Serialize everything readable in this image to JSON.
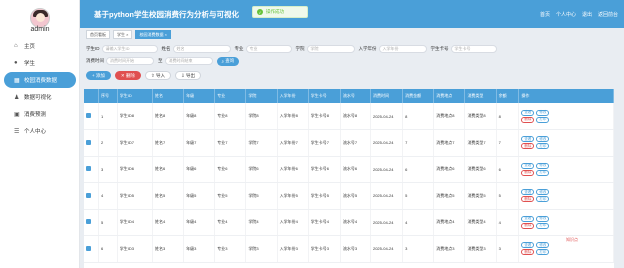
{
  "header": {
    "title": "基于python学生校园消费行为分析与可视化",
    "right_links": [
      "首页",
      "个人中心",
      "退出",
      "返回前台"
    ]
  },
  "toast": {
    "message": "操作成功"
  },
  "sidebar": {
    "username": "admin",
    "items": [
      {
        "label": "主页",
        "icon": "home-icon",
        "active": false
      },
      {
        "label": "学生",
        "icon": "user-icon",
        "active": false
      },
      {
        "label": "校园消费数据",
        "icon": "chart-icon",
        "active": true
      },
      {
        "label": "数据可视化",
        "icon": "person-icon",
        "active": false
      },
      {
        "label": "消费预测",
        "icon": "grid-icon",
        "active": false
      },
      {
        "label": "个人中心",
        "icon": "list-icon",
        "active": false
      }
    ]
  },
  "tabs": [
    {
      "label": "首页看板",
      "active": false
    },
    {
      "label": "学生 ×",
      "active": false
    },
    {
      "label": "校园消费数据 ×",
      "active": true
    }
  ],
  "filters": {
    "row1": [
      {
        "label": "学生ID",
        "placeholder": "请输入学生ID"
      },
      {
        "label": "姓名",
        "placeholder": "姓名"
      },
      {
        "label": "专业",
        "placeholder": "专业"
      },
      {
        "label": "学院",
        "placeholder": "学院"
      },
      {
        "label": "入学年份",
        "placeholder": "入学年份"
      },
      {
        "label": "学生卡号",
        "placeholder": "学生卡号"
      }
    ],
    "row2_label": "消费时间",
    "date_start": "消费时间开始",
    "date_sep": "至",
    "date_end": "消费时间结束",
    "search": "查询"
  },
  "buttons": {
    "add": "添加",
    "delete": "删除",
    "import": "导入",
    "export": "导出"
  },
  "table": {
    "columns": [
      "序号",
      "学生ID",
      "姓名",
      "年级",
      "专业",
      "学院",
      "入学年份",
      "学生卡号",
      "流水号",
      "消费时间",
      "消费金额",
      "消费地点",
      "消费类型",
      "余额",
      "操作"
    ],
    "rows": [
      [
        "1",
        "学生ID8",
        "姓名8",
        "年级8",
        "专业8",
        "学院8",
        "入学年份8",
        "学生卡号8",
        "流水号8",
        "2025-04-24",
        "8",
        "消费地点8",
        "消费类型8",
        "8"
      ],
      [
        "2",
        "学生ID7",
        "姓名7",
        "年级7",
        "专业7",
        "学院7",
        "入学年份7",
        "学生卡号7",
        "流水号7",
        "2025-04-24",
        "7",
        "消费地点7",
        "消费类型7",
        "7"
      ],
      [
        "3",
        "学生ID6",
        "姓名6",
        "年级6",
        "专业6",
        "学院6",
        "入学年份6",
        "学生卡号6",
        "流水号6",
        "2025-04-24",
        "6",
        "消费地点6",
        "消费类型6",
        "6"
      ],
      [
        "4",
        "学生ID5",
        "姓名5",
        "年级5",
        "专业5",
        "学院5",
        "入学年份5",
        "学生卡号5",
        "流水号5",
        "2025-04-24",
        "5",
        "消费地点5",
        "消费类型5",
        "5"
      ],
      [
        "5",
        "学生ID4",
        "姓名4",
        "年级4",
        "专业4",
        "学院4",
        "入学年份4",
        "学生卡号4",
        "流水号4",
        "2025-04-24",
        "4",
        "消费地点4",
        "消费类型4",
        "4"
      ],
      [
        "6",
        "学生ID3",
        "姓名3",
        "年级3",
        "专业3",
        "学院3",
        "入学年份3",
        "学生卡号3",
        "流水号3",
        "2025-04-24",
        "3",
        "消费地点3",
        "消费类型3",
        "3"
      ]
    ],
    "ops": {
      "view": "查看",
      "edit": "修改",
      "delete": "删除",
      "print": "打印"
    }
  },
  "watermark": "知识点",
  "colors": {
    "primary": "#4a9fd8",
    "danger": "#e05050",
    "success": "#67c23a"
  }
}
